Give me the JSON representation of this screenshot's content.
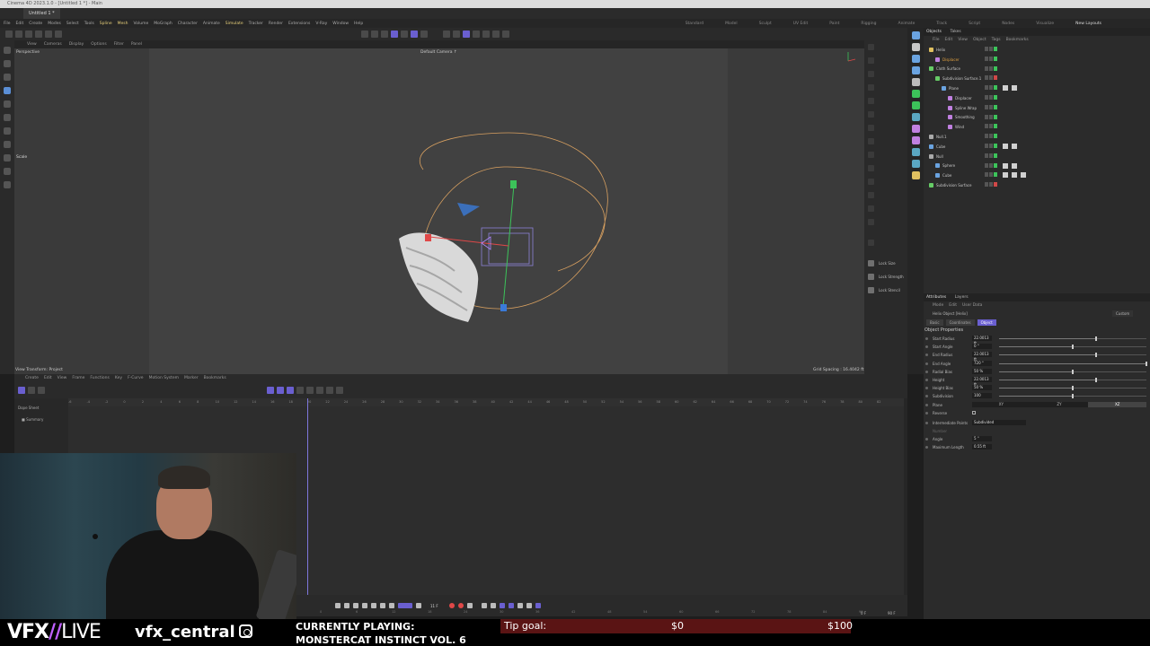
{
  "window": {
    "title": "Cinema 4D 2023.1.0 - [Untitled 1 *] - Main",
    "doc_tab": "Untitled 1 *"
  },
  "menus": [
    "File",
    "Edit",
    "Create",
    "Modes",
    "Select",
    "Tools",
    "Spline",
    "Mesh",
    "Volume",
    "MoGraph",
    "Character",
    "Animate",
    "Simulate",
    "Tracker",
    "Render",
    "Extensions",
    "V-Ray",
    "Window",
    "Help"
  ],
  "layouts": [
    "Standard",
    "Model",
    "Sculpt",
    "UV Edit",
    "Paint",
    "Rigging",
    "Animate",
    "Track",
    "Script",
    "Nodes",
    "Visualize",
    "New Layouts"
  ],
  "viewport": {
    "menu": [
      "View",
      "Cameras",
      "Display",
      "Options",
      "Filter",
      "Panel"
    ],
    "view_name": "Perspective",
    "camera": "Default Camera",
    "tool": "Scale",
    "status_left": "View Transform: Project",
    "grid_spacing": "Grid Spacing : 16.4042 ft"
  },
  "sculpt_tools": [
    "Lock Size",
    "Lock Strength",
    "Lock Stencil"
  ],
  "objects_panel": {
    "tabs": [
      "Objects",
      "Takes"
    ],
    "menu": [
      "File",
      "Edit",
      "View",
      "Object",
      "Tags",
      "Bookmarks"
    ],
    "items": [
      {
        "name": "Helix",
        "indent": 0,
        "color": "#e0c060",
        "tags": 0
      },
      {
        "name": "Displacer",
        "indent": 1,
        "color": "#c080e0",
        "tags": 0
      },
      {
        "name": "Cloth Surface",
        "indent": 0,
        "color": "#66cc66",
        "tags": 0
      },
      {
        "name": "Subdivision Surface.1",
        "indent": 1,
        "color": "#66cc66",
        "tags": 0
      },
      {
        "name": "Plane",
        "indent": 2,
        "color": "#6aa3e0",
        "tags": 2
      },
      {
        "name": "Displacer",
        "indent": 3,
        "color": "#c080e0",
        "tags": 0
      },
      {
        "name": "Spline Wrap",
        "indent": 3,
        "color": "#c080e0",
        "tags": 0
      },
      {
        "name": "Smoothing",
        "indent": 3,
        "color": "#c080e0",
        "tags": 0
      },
      {
        "name": "Wind",
        "indent": 3,
        "color": "#c080e0",
        "tags": 0
      },
      {
        "name": "Null.1",
        "indent": 0,
        "color": "#aaaaaa",
        "tags": 0
      },
      {
        "name": "Cube",
        "indent": 0,
        "color": "#6aa3e0",
        "tags": 2
      },
      {
        "name": "Null",
        "indent": 0,
        "color": "#aaaaaa",
        "tags": 0
      },
      {
        "name": "Sphere",
        "indent": 1,
        "color": "#6aa3e0",
        "tags": 2
      },
      {
        "name": "Cube",
        "indent": 1,
        "color": "#6aa3e0",
        "tags": 3
      },
      {
        "name": "Subdivision Surface",
        "indent": 0,
        "color": "#66cc66",
        "tags": 0
      }
    ]
  },
  "attributes_panel": {
    "tabs": [
      "Attributes",
      "Layers"
    ],
    "menu": [
      "Mode",
      "Edit",
      "User Data"
    ],
    "object_label": "Helix Object [Helix]",
    "preset": "Custom",
    "subtabs": [
      "Basic",
      "Coordinates",
      "Object"
    ],
    "section": "Object Properties",
    "fields": [
      {
        "label": "Start Radius",
        "value": "22.0013 ft",
        "level": 0.66
      },
      {
        "label": "Start Angle",
        "value": "0 °",
        "level": 0.5
      },
      {
        "label": "End Radius",
        "value": "22.0013 ft",
        "level": 0.66
      },
      {
        "label": "End Angle",
        "value": "720 °",
        "level": 1.0
      },
      {
        "label": "Radial Bias",
        "value": "50 %",
        "level": 0.5
      },
      {
        "label": "Height",
        "value": "22.0013 ft",
        "level": 0.66
      },
      {
        "label": "Height Bias",
        "value": "50 %",
        "level": 0.5
      },
      {
        "label": "Subdivision",
        "value": "100",
        "level": 0.5
      }
    ],
    "plane_label": "Plane",
    "plane_options": [
      "XY",
      "ZY",
      "XZ"
    ],
    "reverse_label": "Reverse",
    "intermediate_label": "Intermediate Points",
    "intermediate_value": "Subdivided",
    "number_label": "Number",
    "angle_label": "Angle",
    "angle_value": "5 °",
    "maxlen_label": "Maximum Length",
    "maxlen_value": "0.55 ft"
  },
  "timeline": {
    "menu": [
      "Create",
      "Edit",
      "View",
      "Frame",
      "Functions",
      "Key",
      "F-Curve",
      "Motion System",
      "Marker",
      "Bookmarks"
    ],
    "left_items": [
      "Dope Sheet",
      "Summary"
    ],
    "ruler_ticks": [
      "-6",
      "-4",
      "-2",
      "0",
      "2",
      "4",
      "6",
      "8",
      "10",
      "12",
      "14",
      "16",
      "18",
      "20",
      "22",
      "24",
      "26",
      "28",
      "30",
      "32",
      "34",
      "36",
      "38",
      "40",
      "42",
      "44",
      "46",
      "48",
      "50",
      "52",
      "54",
      "56",
      "58",
      "60",
      "62",
      "64",
      "66",
      "68",
      "70",
      "72",
      "74",
      "76",
      "78",
      "80",
      "82"
    ],
    "bottom_ticks": [
      "0",
      "6",
      "12",
      "18",
      "24",
      "30",
      "36",
      "42",
      "48",
      "54",
      "60",
      "66",
      "72",
      "78",
      "84",
      "90"
    ],
    "current_frame": "11 F",
    "start_frame": "0 F",
    "end_frame": "90 F"
  },
  "stream": {
    "brand_bold": "VFX",
    "brand_sep": "//",
    "brand_live": "LIVE",
    "handle": "vfx_central",
    "playing_label": "CURRENTLY PLAYING:",
    "playing_title": "MONSTERCAT INSTINCT VOL. 6",
    "tip_label": "Tip goal:",
    "tip_current": "$0",
    "tip_goal": "$100"
  },
  "colors": {
    "accent": "#6a5fd0",
    "helix_spline": "#d8a060",
    "axis_y": "#3cc35a",
    "axis_x": "#e04848",
    "axis_z": "#3a7ad8"
  }
}
